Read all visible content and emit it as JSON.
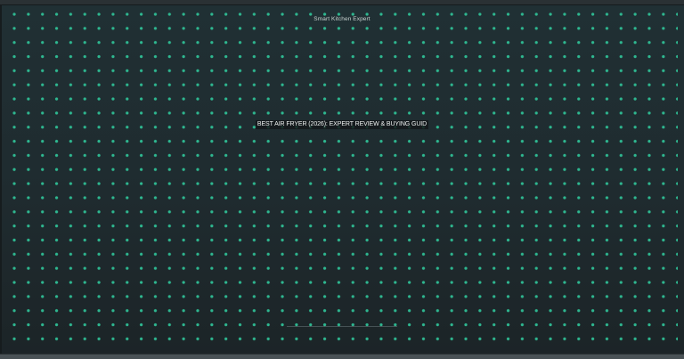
{
  "brand": {
    "name": "Smart Kitchen Expert"
  },
  "article": {
    "headline": "BEST AIR FRYER (2026): EXPERT REVIEW & BUYING GUID"
  },
  "colors": {
    "background": "#1f2b2f",
    "dot_accent": "#2fbf95",
    "headline_text": "#eef2f1"
  }
}
